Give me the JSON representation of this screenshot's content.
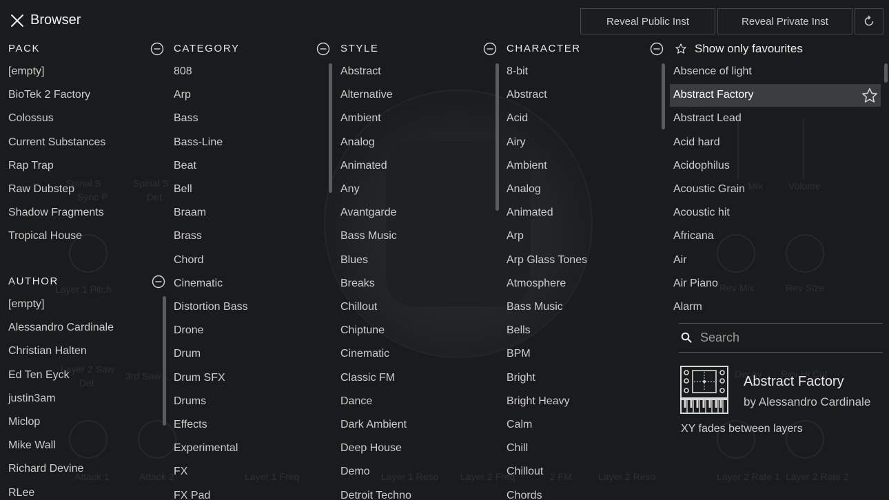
{
  "header": {
    "title": "Browser",
    "reveal_public": "Reveal Public Inst",
    "reveal_private": "Reveal Private Inst"
  },
  "background_labels": [
    "Spinal S",
    "Sync P",
    "Spinal S",
    "Det",
    "Layer 1 Pitch",
    "Layer 2 Saw",
    "Det",
    "3rd Saw L",
    "Attack 1",
    "Attack 2",
    "Layer 1 Freq",
    "Layer 1 Reso",
    "Layer 2 Freq",
    "2 FM",
    "Layer 2 Reso",
    "Layer 2 Rate 1",
    "Layer 2 Rate 2",
    "Mix",
    "Volume",
    "Rev Mix",
    "Rev Size",
    "Decay",
    "Rev Hi Cut"
  ],
  "pack": {
    "header": "PACK",
    "items": [
      "[empty]",
      "BioTek 2 Factory",
      "Colossus",
      "Current Substances",
      "Rap Trap",
      "Raw Dubstep",
      "Shadow Fragments",
      "Tropical House"
    ]
  },
  "author": {
    "header": "AUTHOR",
    "items": [
      "[empty]",
      "Alessandro Cardinale",
      "Christian Halten",
      "Ed Ten Eyck",
      "justin3am",
      "Miclop",
      "Mike Wall",
      "Richard Devine",
      "RLee"
    ]
  },
  "category": {
    "header": "CATEGORY",
    "items": [
      "808",
      "Arp",
      "Bass",
      "Bass-Line",
      "Beat",
      "Bell",
      "Braam",
      "Brass",
      "Chord",
      "Cinematic",
      "Distortion Bass",
      "Drone",
      "Drum",
      "Drum SFX",
      "Drums",
      "Effects",
      "Experimental",
      "FX",
      "FX Pad"
    ]
  },
  "style": {
    "header": "STYLE",
    "items": [
      "Abstract",
      "Alternative",
      "Ambient",
      "Analog",
      "Animated",
      "Any",
      "Avantgarde",
      "Bass Music",
      "Blues",
      "Breaks",
      "Chillout",
      "Chiptune",
      "Cinematic",
      "Classic FM",
      "Dance",
      "Dark Ambient",
      "Deep House",
      "Demo",
      "Detroit Techno"
    ]
  },
  "character": {
    "header": "CHARACTER",
    "items": [
      "8-bit",
      "Abstract",
      "Acid",
      "Airy",
      "Ambient",
      "Analog",
      "Animated",
      "Arp",
      "Arp Glass Tones",
      "Atmosphere",
      "Bass Music",
      "Bells",
      "BPM",
      "Bright",
      "Bright Heavy",
      "Calm",
      "Chill",
      "Chillout",
      "Chords"
    ]
  },
  "presets": {
    "header": "Show only favourites",
    "selected_index": 1,
    "items": [
      "Absence of light",
      "Abstract Factory",
      "Abstract Lead",
      "Acid hard",
      "Acidophilus",
      "Acoustic Grain",
      "Acoustic hit",
      "Africana",
      "Air",
      "Air Piano",
      "Alarm"
    ]
  },
  "search": {
    "placeholder": "Search",
    "value": ""
  },
  "preview": {
    "name": "Abstract Factory",
    "author": "by Alessandro Cardinale",
    "description": "XY fades between layers"
  },
  "colors": {
    "background": "#1a1b1d",
    "selected_row": "#3a3c40",
    "button_border": "#46484c",
    "text": "#cdcdcd"
  },
  "icons": [
    "close-icon",
    "refresh-icon",
    "collapse-icon",
    "star-outline-icon",
    "search-icon",
    "instrument-icon"
  ]
}
